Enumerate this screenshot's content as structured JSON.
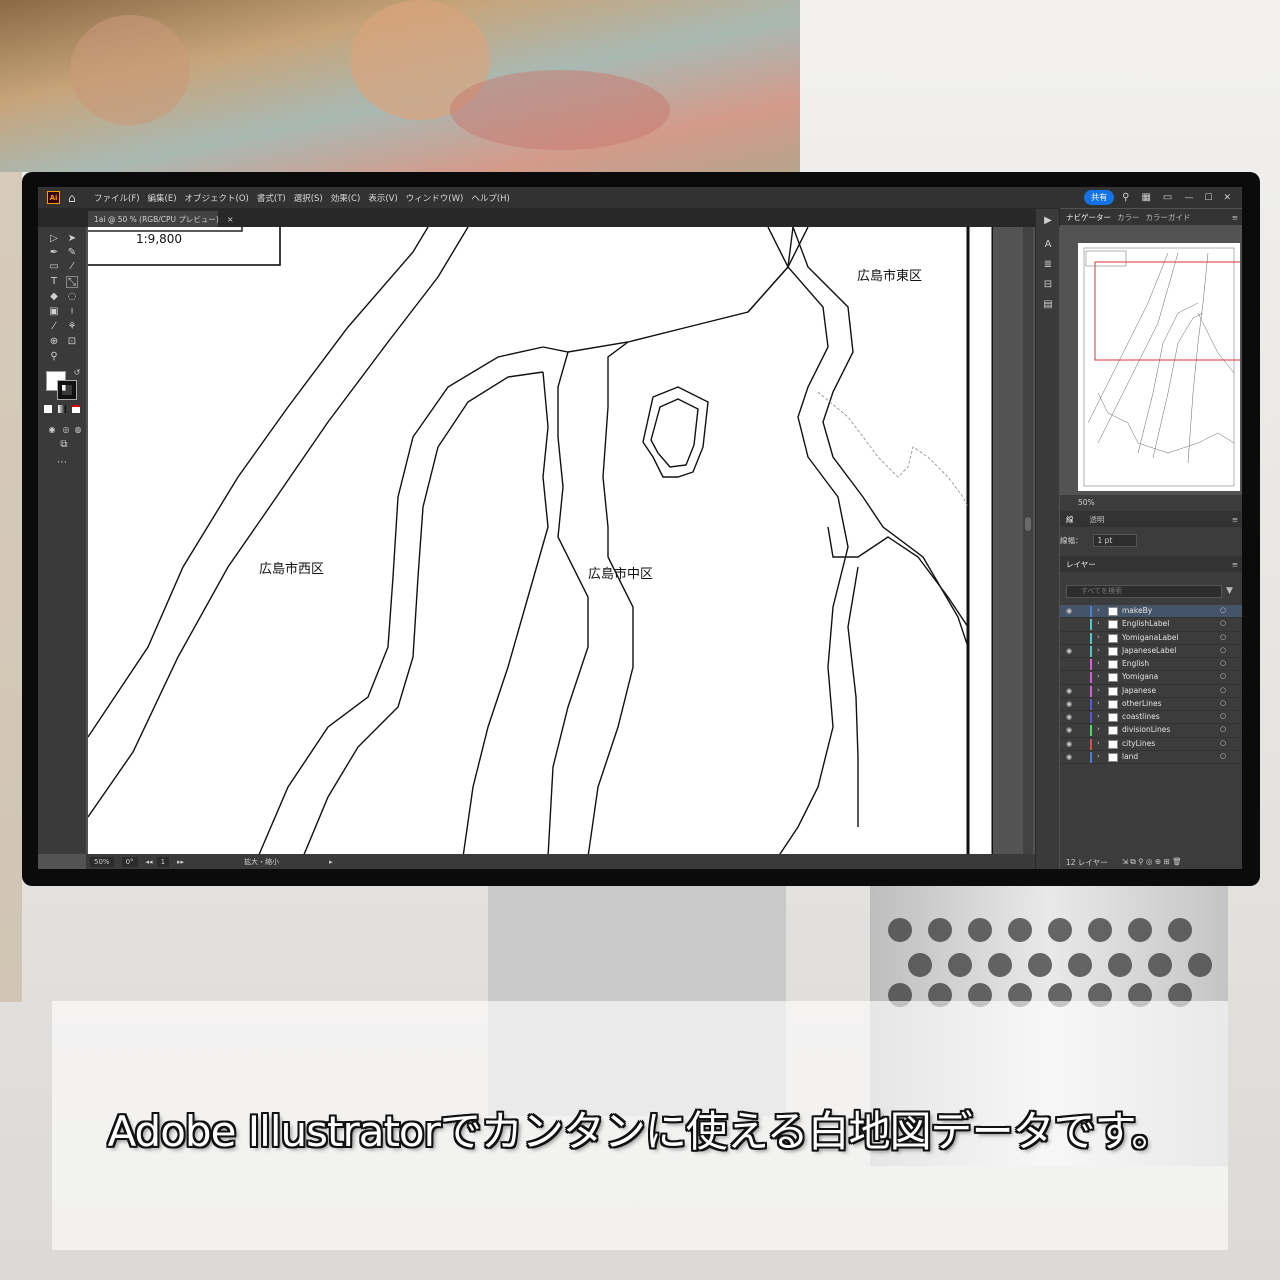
{
  "app": {
    "logo": "Ai",
    "menu": [
      "ファイル(F)",
      "編集(E)",
      "オブジェクト(O)",
      "書式(T)",
      "選択(S)",
      "効果(C)",
      "表示(V)",
      "ウィンドウ(W)",
      "ヘルプ(H)"
    ],
    "share_label": "共有"
  },
  "document": {
    "tab_title": "1ai @ 50 % (RGB/CPU プレビュー)",
    "tab_close": "×"
  },
  "map": {
    "scale_text": "1:9,800",
    "labels": {
      "east": "広島市東区",
      "west": "広島市西区",
      "central": "広島市中区"
    }
  },
  "statusbar": {
    "zoom": "50%",
    "rotation": "0°",
    "artboard": "1",
    "tool_hint": "拡大・縮小"
  },
  "panels": {
    "top_tabs": [
      "ナビゲーター",
      "カラー",
      "カラーガイド"
    ],
    "navigator_zoom": "50%",
    "stroke_tabs": [
      "線",
      "透明"
    ],
    "stroke_weight_label": "線幅：",
    "stroke_weight_value": "1 pt",
    "layers_tab": "レイヤー",
    "layers_search_placeholder": "すべてを検索",
    "layers_count": "12 レイヤー",
    "layers": [
      {
        "name": "makeBy",
        "color": "#4f7fd8",
        "visible": true,
        "selected": true
      },
      {
        "name": "EnglishLabel",
        "color": "#4fc9c9",
        "visible": false,
        "selected": false
      },
      {
        "name": "YomiganaLabel",
        "color": "#4fc9c9",
        "visible": false,
        "selected": false
      },
      {
        "name": "JapaneseLabel",
        "color": "#4fc9c9",
        "visible": true,
        "selected": false
      },
      {
        "name": "English",
        "color": "#d65fd6",
        "visible": false,
        "selected": false
      },
      {
        "name": "Yomigana",
        "color": "#d65fd6",
        "visible": false,
        "selected": false
      },
      {
        "name": "Japanese",
        "color": "#d65fd6",
        "visible": true,
        "selected": false
      },
      {
        "name": "otherLines",
        "color": "#5a5ad6",
        "visible": true,
        "selected": false
      },
      {
        "name": "coastlines",
        "color": "#5a5ad6",
        "visible": true,
        "selected": false
      },
      {
        "name": "divisionLines",
        "color": "#4fd66a",
        "visible": true,
        "selected": false
      },
      {
        "name": "cityLines",
        "color": "#d64f4f",
        "visible": true,
        "selected": false
      },
      {
        "name": "land",
        "color": "#4f7fd8",
        "visible": true,
        "selected": false
      }
    ]
  },
  "caption": "Adobe Illustratorでカンタンに使える白地図データです。"
}
